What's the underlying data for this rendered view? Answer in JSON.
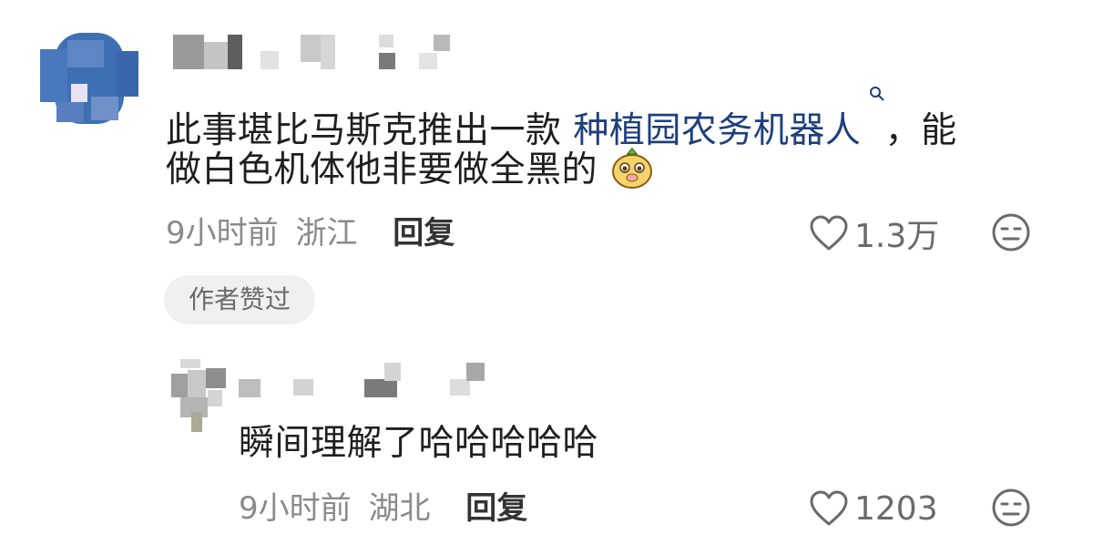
{
  "comments": [
    {
      "text_before_link": "此事堪比马斯克推出一款 ",
      "link_text": "种植园农务机器人",
      "text_after_link": "，能",
      "text_line2": "做白色机体他非要做全黑的",
      "time": "9小时前",
      "location": "浙江",
      "reply_label": "回复",
      "like_count": "1.3万",
      "badge": "作者赞过"
    },
    {
      "text": "瞬间理解了哈哈哈哈哈",
      "time": "9小时前",
      "location": "湖北",
      "reply_label": "回复",
      "like_count": "1203"
    }
  ],
  "icons": {
    "search": "search-icon",
    "emoji": "bear-sticker-icon",
    "like": "heart-icon",
    "dislike": "unamused-face-icon"
  },
  "colors": {
    "link": "#1d3f7c",
    "meta": "#8a8a8a",
    "badge_bg": "#f0f0f0"
  }
}
